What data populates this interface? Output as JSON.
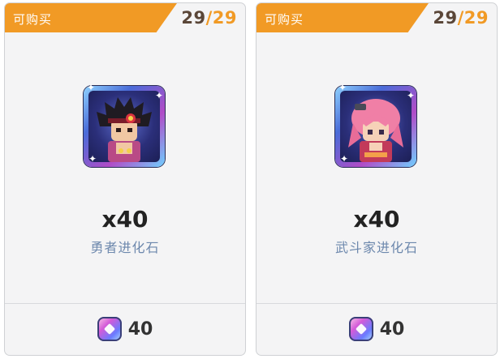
{
  "items": [
    {
      "banner_label": "可购买",
      "stock_current": "29",
      "stock_separator": "/",
      "stock_max": "29",
      "icon": "hero-portrait-icon",
      "quantity": "x40",
      "name": "勇者进化石",
      "price": "40",
      "currency_icon": "gem-currency-icon"
    },
    {
      "banner_label": "可购买",
      "stock_current": "29",
      "stock_separator": "/",
      "stock_max": "29",
      "icon": "fighter-portrait-icon",
      "quantity": "x40",
      "name": "武斗家进化石",
      "price": "40",
      "currency_icon": "gem-currency-icon"
    }
  ],
  "colors": {
    "banner": "#f19a25",
    "card_bg": "#f4f4f5",
    "item_name": "#6d88ad",
    "stock_current": "#5a4638"
  }
}
